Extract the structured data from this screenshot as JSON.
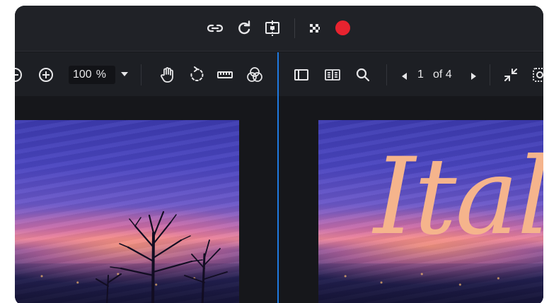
{
  "topbar": {
    "icons": [
      "link-icon",
      "refresh-icon",
      "compare-icon",
      "checkerboard-icon",
      "record-icon"
    ],
    "record_color": "#e8232f"
  },
  "toolbar": {
    "zoom_value": "100",
    "zoom_unit": "%",
    "page_current": "1",
    "page_total_label": "of 4",
    "icons": [
      "zoom-out-icon",
      "zoom-in-icon",
      "hand-icon",
      "rotate-icon",
      "ruler-icon",
      "color-channels-icon",
      "sidebar-icon",
      "two-page-icon",
      "search-icon",
      "prev-page-icon",
      "next-page-icon",
      "collapse-icon",
      "fit-icon"
    ]
  },
  "document": {
    "title_text": "Italy"
  },
  "colors": {
    "accent": "#1f7ae0",
    "background": "#16171b"
  }
}
